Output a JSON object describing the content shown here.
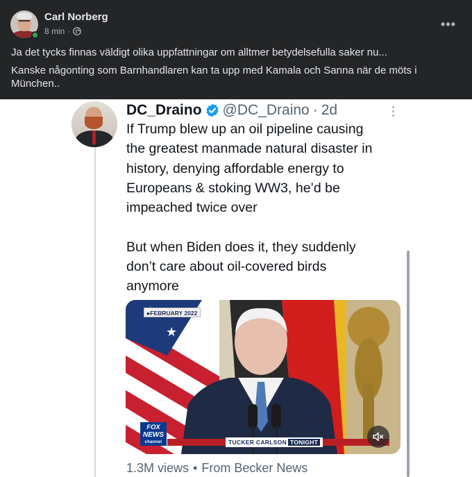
{
  "post": {
    "author": "Carl Norberg",
    "time": "8 min",
    "meta_sep": "·",
    "more_label": "•••",
    "text_1": "Ja det tycks finnas väldigt olika uppfattningar om alltmer betydelsefulla saker nu...",
    "text_2": "Kanske någonting som Barnhandlaren kan ta upp med Kamala och Sanna när de möts i München..",
    "icons": {
      "avatar": "profile-photo",
      "privacy": "globe-icon",
      "online": "online-dot",
      "more": "more-icon"
    },
    "colors": {
      "background": "#242526",
      "text": "#e4e6eb",
      "secondary_text": "#b0b3b8",
      "online": "#31a24c"
    }
  },
  "tweet": {
    "name": "DC_Draino",
    "handle": "@DC_Draino",
    "separator": "·",
    "age": "2d",
    "lines": [
      "If Trump blew up an oil pipeline causing",
      "the greatest manmade natural disaster in",
      "history, denying affordable energy to",
      "Europeans & stoking WW3, he’d be",
      "impeached twice over"
    ],
    "lines_2": [
      "But when Biden does it, they suddenly",
      "don’t care about oil-covered birds",
      "anymore"
    ],
    "media": {
      "date_badge": "▸FEBRUARY 2022",
      "network_logo": "FOX",
      "network_logo_2": "NEWS",
      "network_logo_3": "channel",
      "lower_third": "TUCKER CARLSON",
      "lower_third_tag": "TONIGHT",
      "mute_icon": "speaker-muted-icon"
    },
    "views": "1.3M views",
    "bullet": "•",
    "source": "From Becker News",
    "icons": {
      "verified": "verified-badge-icon",
      "more": "vertical-dots-icon"
    },
    "colors": {
      "verified": "#1d9bf0",
      "name": "#0f1419",
      "secondary": "#536471"
    }
  }
}
